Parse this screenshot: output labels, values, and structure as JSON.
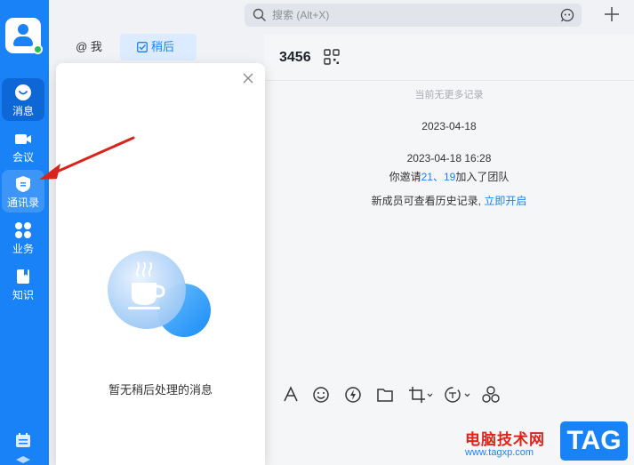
{
  "sidebar": {
    "items": [
      {
        "label": "消息",
        "icon": "chat-bubble-icon"
      },
      {
        "label": "会议",
        "icon": "video-camera-icon"
      },
      {
        "label": "通讯录",
        "icon": "contacts-icon"
      },
      {
        "label": "业务",
        "icon": "apps-grid-icon"
      },
      {
        "label": "知识",
        "icon": "book-icon"
      }
    ],
    "bottom_icon": "calendar-icon"
  },
  "search": {
    "placeholder": "搜索 (Alt+X)"
  },
  "tabs": {
    "mention": "@ 我",
    "later": "稍后"
  },
  "popup": {
    "empty_text": "暂无稍后处理的消息"
  },
  "chat": {
    "title": "3456",
    "no_more": "当前无更多记录",
    "date1": "2023-04-18",
    "date2": "2023-04-18 16:28",
    "invite_prefix": "你邀请",
    "invite_a": "21",
    "invite_sep": "、",
    "invite_b": "19",
    "invite_suffix": "加入了团队",
    "history_text": "新成员可查看历史记录,",
    "history_link": "立即开启"
  },
  "watermark": {
    "site": "电脑技术网",
    "url": "www.tagxp.com",
    "tag": "TAG"
  },
  "colors": {
    "primary": "#1a82f7",
    "arrow": "#d9241b"
  }
}
